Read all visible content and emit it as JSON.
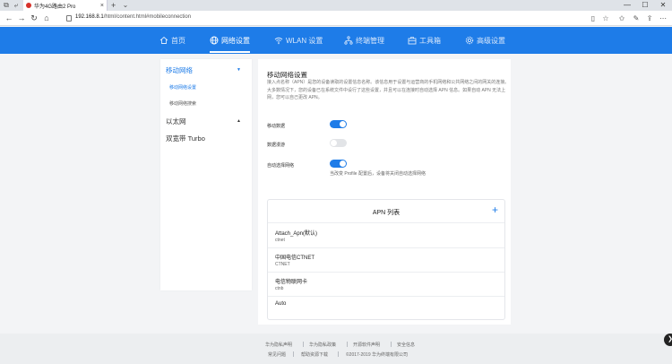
{
  "browser": {
    "tab_title": "华为4G路由2 Pro",
    "url_host": "192.168.8.1",
    "url_path": "/html/content.html#mobileconnection",
    "new_tab": "+",
    "tab_close": "×",
    "win_minimize": "—",
    "win_maximize": "☐",
    "win_close": "✕"
  },
  "nav": {
    "items": [
      {
        "label": "首页",
        "icon": "home-icon"
      },
      {
        "label": "网络设置",
        "icon": "globe-icon",
        "active": true
      },
      {
        "label": "WLAN 设置",
        "icon": "wifi-icon"
      },
      {
        "label": "终端管理",
        "icon": "devices-icon"
      },
      {
        "label": "工具箱",
        "icon": "toolbox-icon"
      },
      {
        "label": "高级设置",
        "icon": "gear-icon"
      }
    ]
  },
  "sidebar": {
    "groups": [
      {
        "label": "移动网络",
        "expanded": true,
        "children": [
          "移动网络设置",
          "移动网络搜索"
        ]
      },
      {
        "label": "以太网",
        "expanded": true
      },
      {
        "label": "双宽带 Turbo"
      }
    ]
  },
  "main": {
    "title": "移动网络设置",
    "description": "接入点名称（APN）是您的设备读取的设置信息名称。该信息用于设置与运营商的手机网络和公共网络之间的网关的连接。大多数情况下，您的设备已在系统文件中设行了这些设置，并且可以在连接时自动选择 APN 信息。如果自动 APN 无法上网，您可以自己更改 APN。",
    "rows": {
      "mobile_data": "移动数据",
      "roaming": "数据漫游",
      "auto_network": "自动选择网络"
    },
    "toggles": {
      "mobile_data": true,
      "roaming": false,
      "auto_network": true
    },
    "hint": "当改变 Profile 配置后，设备将关闭自动选择网络",
    "apn": {
      "title": "APN 列表",
      "add": "+",
      "items": [
        {
          "name": "Attach_Apn(默认)",
          "apn": "ctnet"
        },
        {
          "name": "中国电信CTNET",
          "apn": "CTNET"
        },
        {
          "name": "电信物联网卡",
          "apn": "ctnb"
        },
        {
          "name": "Auto",
          "apn": ""
        }
      ]
    }
  },
  "footer": {
    "links_row1": [
      "华为隐私声明",
      "华为隐私政策",
      "开源软件声明",
      "安全信息"
    ],
    "links_row2": [
      "常见问题",
      "帮助资源下载",
      "©2017-2019 华为终端有限公司"
    ]
  },
  "colors": {
    "brand": "#1e7ce8",
    "page_bg": "#f3f4f6"
  }
}
